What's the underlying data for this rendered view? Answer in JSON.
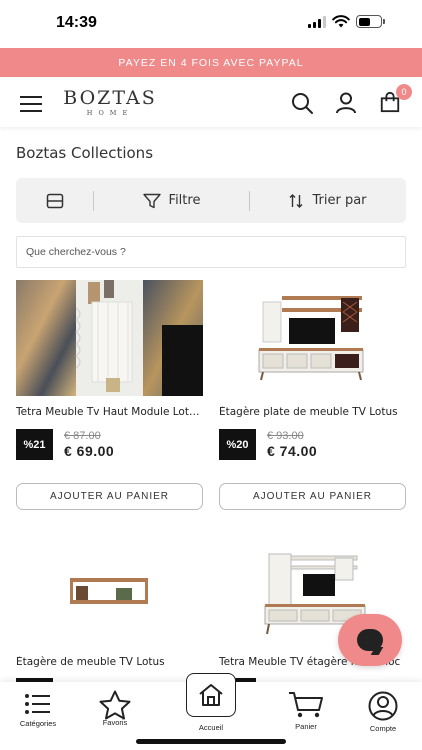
{
  "status_bar": {
    "time": "14:39"
  },
  "promo": {
    "text": "PAYEZ EN 4 FOIS AVEC PAYPAL",
    "color": "#f08a8a"
  },
  "header": {
    "logo": "BOZTAS",
    "logo_sub": "HOME",
    "icons": [
      "menu-icon",
      "search-icon",
      "user-icon",
      "shopping-bag-icon"
    ],
    "cart_count": "0"
  },
  "page": {
    "title": "Boztas Collections"
  },
  "toolbar": {
    "layout_icon": "layout-toggle-icon",
    "filter_label": "Filtre",
    "sort_label": "Trier par"
  },
  "search": {
    "placeholder": "Que cherchez-vous ?"
  },
  "products": [
    {
      "title": "Tetra Meuble Tv Haut Module Lotus Blanc",
      "discount": "%21",
      "old_price": "€ 87.00",
      "price": "€ 69.00",
      "button": "AJOUTER AU PANIER"
    },
    {
      "title": "Étagère plate de meuble TV Lotus",
      "discount": "%20",
      "old_price": "€ 93.00",
      "price": "€ 74.00",
      "button": "AJOUTER AU PANIER"
    },
    {
      "title": "Étagère de meuble TV Lotus"
    },
    {
      "title": "Tetra Meuble TV étagère haut Bloc"
    }
  ],
  "bottom_nav": {
    "items": [
      {
        "label": "Catégories",
        "icon": "list-icon"
      },
      {
        "label": "Favoris",
        "icon": "star-icon"
      },
      {
        "label": "Accueil",
        "icon": "home-icon"
      },
      {
        "label": "Panier",
        "icon": "cart-icon"
      },
      {
        "label": "Compte",
        "icon": "account-icon"
      }
    ]
  },
  "colors": {
    "accent": "#f08a8a",
    "badge": "#111111",
    "toolbar_bg": "#f1f1f1"
  }
}
